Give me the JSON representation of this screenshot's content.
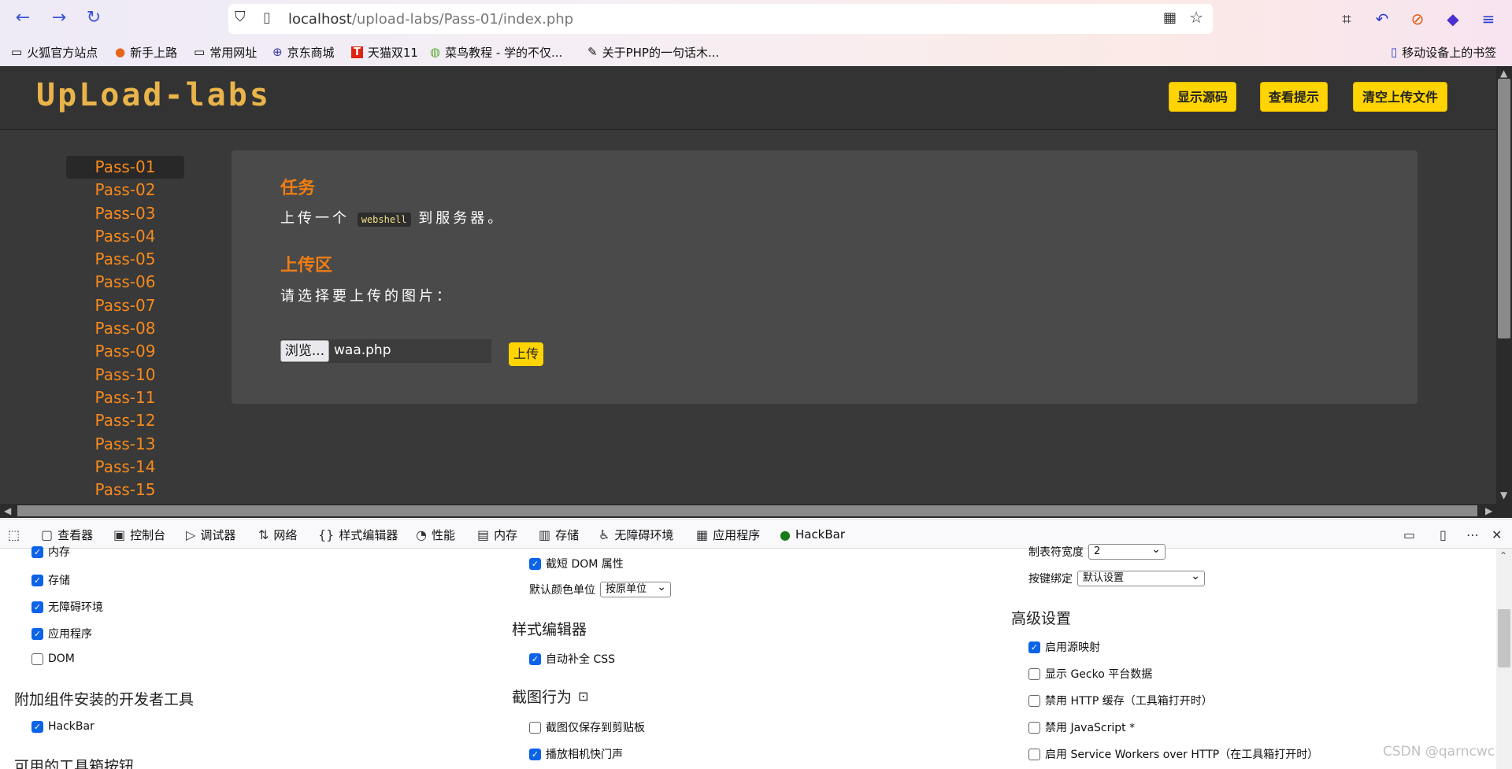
{
  "browser": {
    "url_host": "localhost",
    "url_path": "/upload-labs/Pass-01/index.php",
    "bookmarks": [
      {
        "label": "火狐官方站点",
        "icon": "folder-icon"
      },
      {
        "label": "新手上路",
        "icon": "firefox-icon"
      },
      {
        "label": "常用网址",
        "icon": "folder-icon"
      },
      {
        "label": "京东商城",
        "icon": "globe-icon"
      },
      {
        "label": "天猫双11",
        "icon": "tmall-icon"
      },
      {
        "label": "菜鸟教程 - 学的不仅...",
        "icon": "runoob-icon"
      },
      {
        "label": "关于PHP的一句话木...",
        "icon": "script-icon"
      }
    ],
    "mobile_bookmarks": "移动设备上的书签"
  },
  "page": {
    "logo": "UpLoad-labs",
    "header_buttons": [
      "显示源码",
      "查看提示",
      "清空上传文件"
    ],
    "passes": [
      "Pass-01",
      "Pass-02",
      "Pass-03",
      "Pass-04",
      "Pass-05",
      "Pass-06",
      "Pass-07",
      "Pass-08",
      "Pass-09",
      "Pass-10",
      "Pass-11",
      "Pass-12",
      "Pass-13",
      "Pass-14",
      "Pass-15"
    ],
    "task_title": "任务",
    "task_text_before": "上传一个",
    "task_code": "webshell",
    "task_text_after": "到服务器。",
    "upload_title": "上传区",
    "upload_prompt": "请选择要上传的图片：",
    "browse_label": "浏览...",
    "filename": "waa.php",
    "upload_button": "上传"
  },
  "devtools": {
    "tabs": [
      {
        "label": "查看器",
        "icon": "inspector-icon"
      },
      {
        "label": "控制台",
        "icon": "console-icon"
      },
      {
        "label": "调试器",
        "icon": "debugger-icon"
      },
      {
        "label": "网络",
        "icon": "network-icon"
      },
      {
        "label": "样式编辑器",
        "icon": "style-editor-icon"
      },
      {
        "label": "性能",
        "icon": "performance-icon"
      },
      {
        "label": "内存",
        "icon": "memory-icon"
      },
      {
        "label": "存储",
        "icon": "storage-icon"
      },
      {
        "label": "无障碍环境",
        "icon": "accessibility-icon"
      },
      {
        "label": "应用程序",
        "icon": "application-icon"
      },
      {
        "label": "HackBar",
        "icon": "hackbar-icon"
      }
    ],
    "col1_options": [
      {
        "label": "内存",
        "checked": true
      },
      {
        "label": "存储",
        "checked": true
      },
      {
        "label": "无障碍环境",
        "checked": true
      },
      {
        "label": "应用程序",
        "checked": true
      },
      {
        "label": "DOM",
        "checked": false
      }
    ],
    "addon_heading": "附加组件安装的开发者工具",
    "addon_option": {
      "label": "HackBar",
      "checked": true
    },
    "toolbox_heading": "可用的工具箱按钮",
    "col2_truncate": {
      "label": "截短 DOM 属性",
      "checked": true
    },
    "color_unit_label": "默认颜色单位",
    "color_unit_value": "按原单位",
    "style_heading": "样式编辑器",
    "autocomplete": {
      "label": "自动补全 CSS",
      "checked": true
    },
    "screenshot_heading": "截图行为",
    "screenshot_options": [
      {
        "label": "截图仅保存到剪贴板",
        "checked": false
      },
      {
        "label": "播放相机快门声",
        "checked": true
      }
    ],
    "tab_width_label": "制表符宽度",
    "tab_width_value": "2",
    "keybind_label": "按键绑定",
    "keybind_value": "默认设置",
    "advanced_heading": "高级设置",
    "advanced_options": [
      {
        "label": "启用源映射",
        "checked": true
      },
      {
        "label": "显示 Gecko 平台数据",
        "checked": false
      },
      {
        "label": "禁用 HTTP 缓存（工具箱打开时）",
        "checked": false
      },
      {
        "label": "禁用 JavaScript *",
        "checked": false
      },
      {
        "label": "启用 Service Workers over HTTP（在工具箱打开时）",
        "checked": false
      }
    ]
  },
  "watermark": "CSDN @qarncwc"
}
